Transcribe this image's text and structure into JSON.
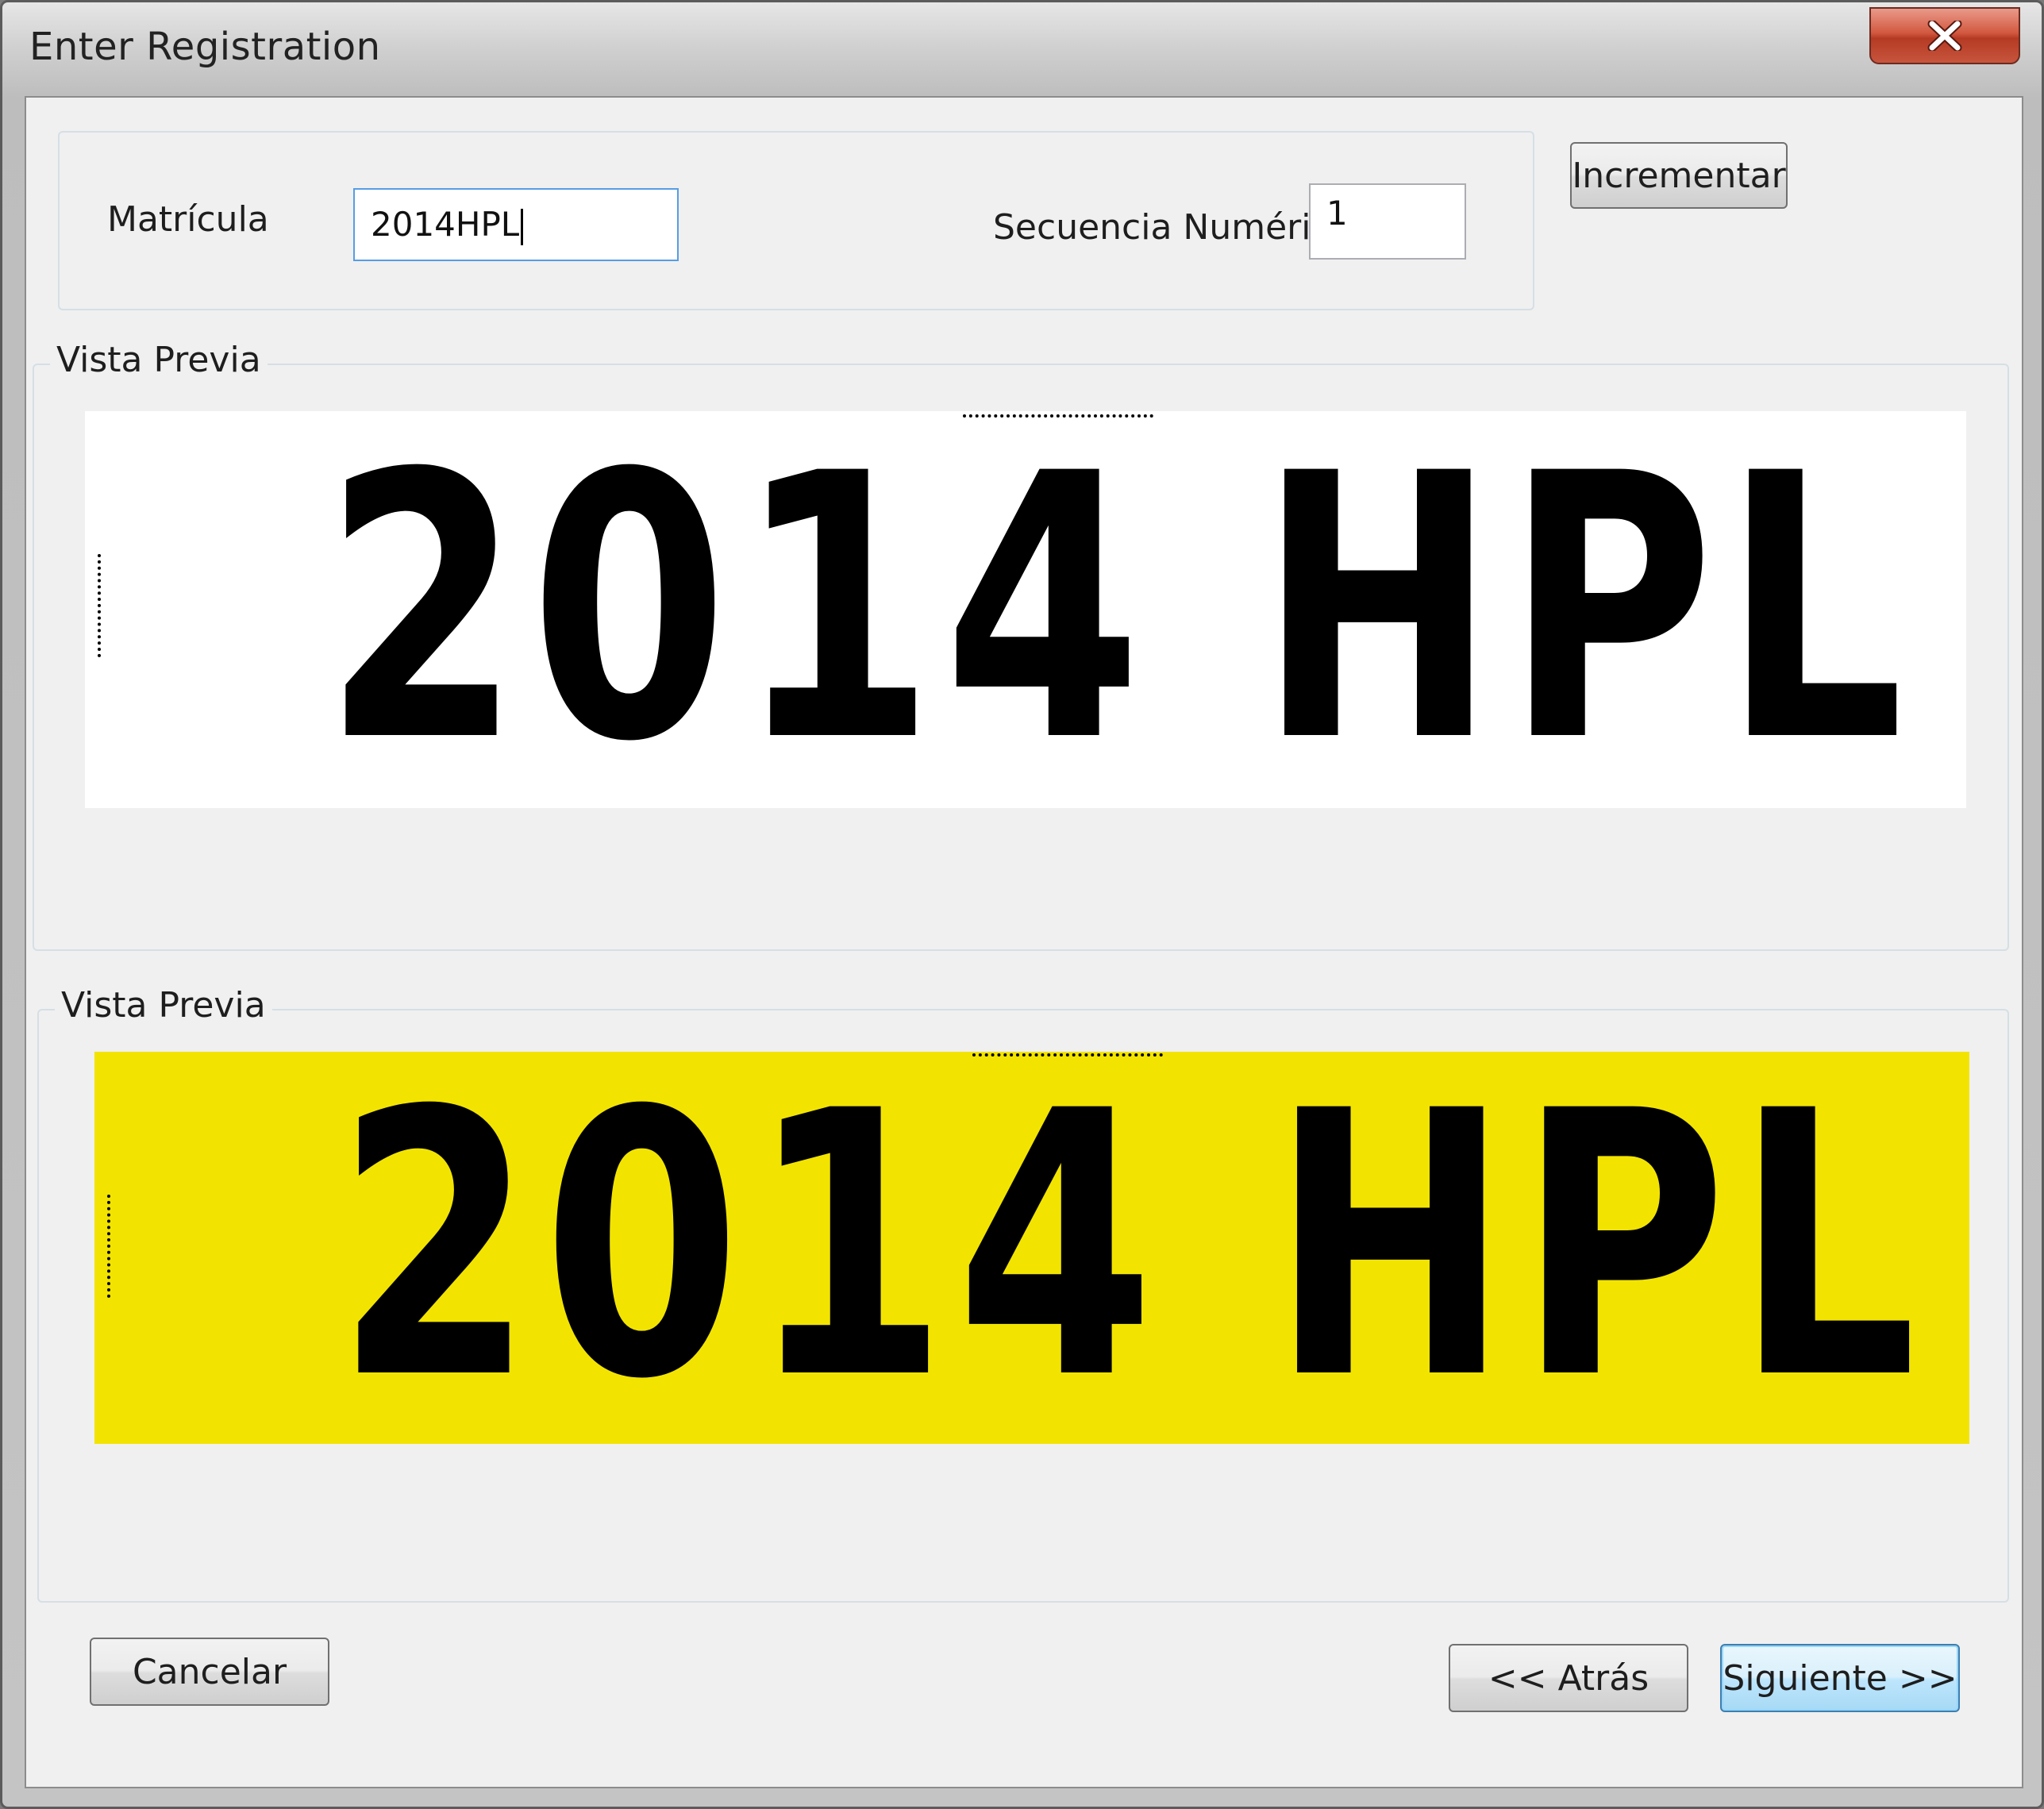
{
  "window": {
    "title": "Enter Registration",
    "close_icon": "close-icon"
  },
  "form": {
    "matricula_label": "Matrícula",
    "matricula_value": "2014HPL",
    "secuencia_label": "Secuencia Numérica",
    "secuencia_value": "1",
    "incrementar_label": "Incrementar"
  },
  "previews": [
    {
      "title": "Vista Previa",
      "plate_text": "2014 HPL",
      "background_color": "#ffffff"
    },
    {
      "title": "Vista Previa",
      "plate_text": "2014 HPL",
      "background_color": "#f2e400"
    }
  ],
  "buttons": {
    "cancel_label": "Cancelar",
    "back_label": "<< Atrás",
    "next_label": "Siguiente >>"
  }
}
